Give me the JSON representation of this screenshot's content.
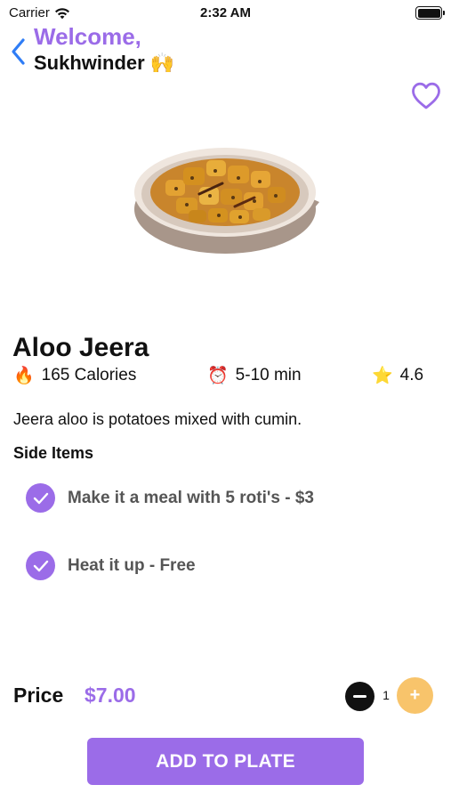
{
  "status_bar": {
    "carrier": "Carrier",
    "time": "2:32 AM",
    "wifi_icon": "wifi-icon",
    "battery_icon": "battery-icon"
  },
  "header": {
    "greeting": "Welcome,",
    "user_name": "Sukhwinder",
    "user_emoji": "🙌",
    "back_icon": "chevron-left-icon",
    "favorite_icon": "heart-outline-icon"
  },
  "dish": {
    "name": "Aloo Jeera",
    "calories": "165 Calories",
    "calories_emoji": "🔥",
    "time": "5-10 min",
    "time_emoji": "⏰",
    "rating": "4.6",
    "rating_emoji": "⭐",
    "description": "Jeera aloo is potatoes mixed with cumin."
  },
  "side_items": {
    "title": "Side Items",
    "items": [
      {
        "label": "Make it a meal with 5 roti's - $3",
        "checked": true
      },
      {
        "label": "Heat it up - Free",
        "checked": true
      }
    ]
  },
  "order": {
    "price_label": "Price",
    "price": "$7.00",
    "quantity": "1",
    "minus_symbol": "−",
    "plus_symbol": "+",
    "add_label": "ADD TO PLATE"
  },
  "colors": {
    "accent": "#9b6ce8",
    "plus_button": "#f8c46b",
    "text": "#111111",
    "side_label": "#555555"
  }
}
